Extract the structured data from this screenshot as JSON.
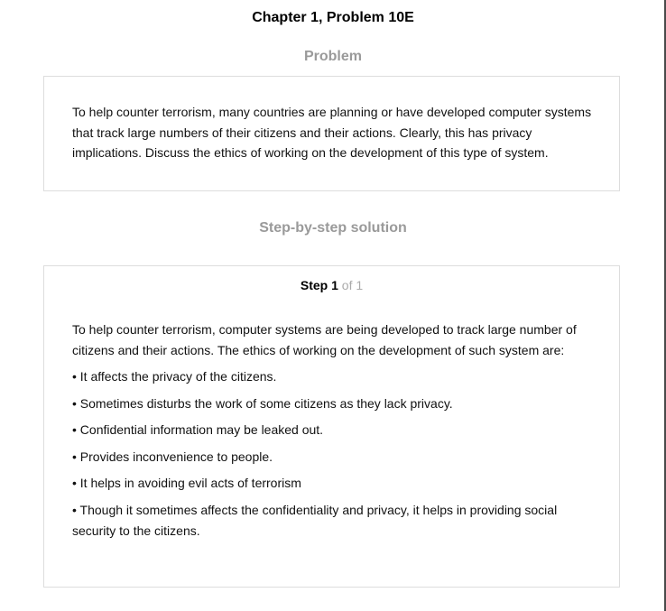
{
  "header": {
    "title": "Chapter 1, Problem 10E"
  },
  "problem": {
    "heading": "Problem",
    "text": "To help counter terrorism, many countries are planning or have developed computer systems that track large numbers of their citizens and their actions. Clearly, this has privacy implications. Discuss the ethics of working on the development of this type of system."
  },
  "solution": {
    "heading": "Step-by-step solution",
    "step_word": "Step",
    "step_number": "1",
    "step_of": "of 1",
    "intro": "To help counter terrorism, computer systems are being developed to track large number of citizens and their actions. The ethics of working on the development of such system are:",
    "bullets": [
      "• It affects the privacy of the citizens.",
      "• Sometimes disturbs the work of some citizens as they lack privacy.",
      "• Confidential information may be leaked out.",
      "• Provides inconvenience to people.",
      "• It helps in avoiding evil acts of terrorism",
      "• Though it sometimes affects the confidentiality and privacy, it helps in providing social security to the citizens."
    ]
  },
  "colors": {
    "heading_gray": "#9a9a9a",
    "border": "#dddddd",
    "step_of_gray": "#aaaaaa"
  }
}
